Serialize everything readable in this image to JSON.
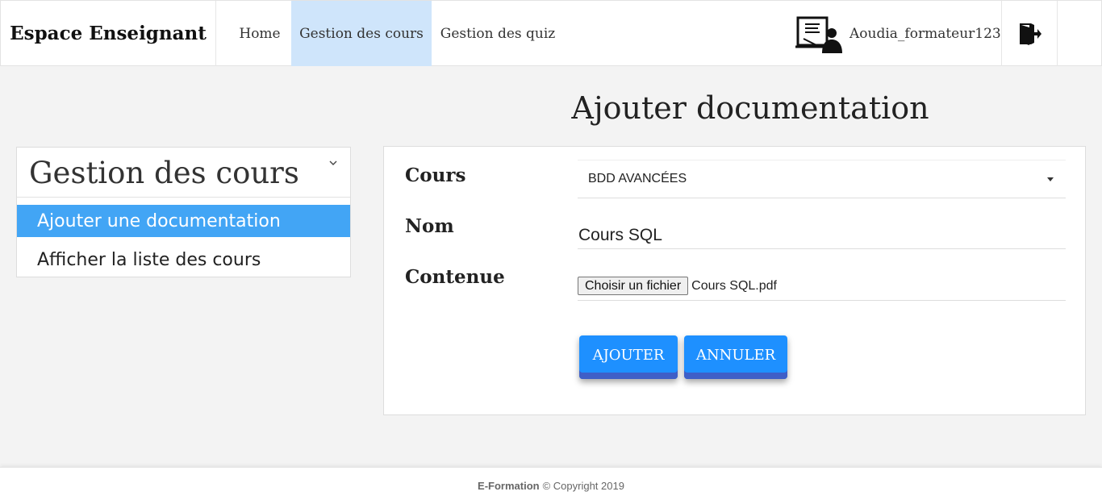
{
  "navbar": {
    "brand": "Espace Enseignant",
    "items": [
      {
        "label": "Home"
      },
      {
        "label": "Gestion des cours"
      },
      {
        "label": "Gestion des quiz"
      }
    ],
    "active_item": "Gestion des cours",
    "active_color": "#cfe5fb",
    "username": "Aoudia_formateur123",
    "user_icon": "teacher-board-icon",
    "logout_icon": "logout-icon"
  },
  "page": {
    "title": "Ajouter documentation"
  },
  "sidebar": {
    "title": "Gestion des cours",
    "chevron_icon": "chevron-down-icon",
    "links": [
      {
        "label": "Ajouter une documentation",
        "active": true
      },
      {
        "label": "Afficher la liste des cours",
        "active": false
      }
    ],
    "active_color": "#42a5f5"
  },
  "form": {
    "cours_label": "Cours",
    "cours_selected": "BDD AVANCÉES",
    "nom_label": "Nom",
    "nom_value": "Cours SQL",
    "contenue_label": "Contenue",
    "file_button": "Choisir un fichier",
    "file_name": "Cours SQL.pdf",
    "submit_label": "AJOUTER",
    "cancel_label": "ANNULER",
    "button_color": "#1e90ff"
  },
  "footer": {
    "brand": "E-Formation",
    "copyright": "© Copyright 2019"
  }
}
